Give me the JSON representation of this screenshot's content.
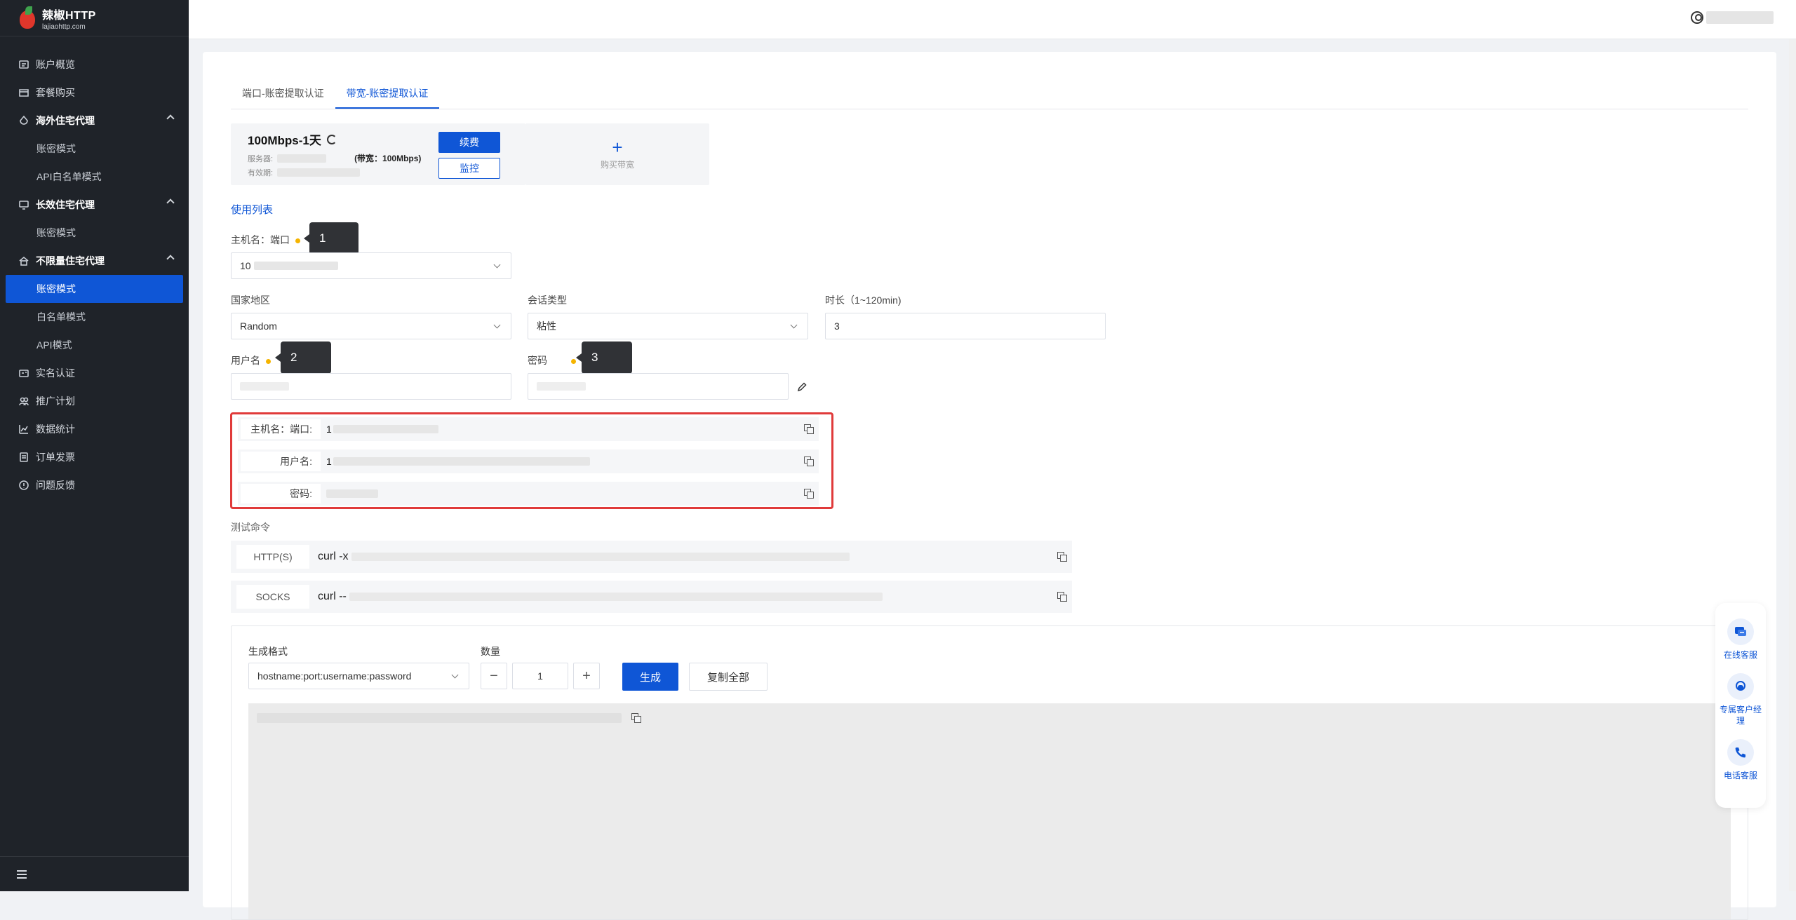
{
  "brand": {
    "name": "辣椒HTTP",
    "domain": "lajiaohttp.com"
  },
  "sidebar": {
    "items": [
      {
        "label": "账户概览",
        "icon": "dashboard-icon",
        "type": "item"
      },
      {
        "label": "套餐购买",
        "icon": "package-icon",
        "type": "item"
      },
      {
        "label": "海外住宅代理",
        "icon": "residential-icon",
        "type": "group"
      },
      {
        "label": "账密模式",
        "type": "sub"
      },
      {
        "label": "API白名单模式",
        "type": "sub"
      },
      {
        "label": "长效住宅代理",
        "icon": "monitor-icon",
        "type": "group"
      },
      {
        "label": "账密模式",
        "type": "sub"
      },
      {
        "label": "不限量住宅代理",
        "icon": "home-icon",
        "type": "group"
      },
      {
        "label": "账密模式",
        "type": "sub-active"
      },
      {
        "label": "白名单模式",
        "type": "sub"
      },
      {
        "label": "API模式",
        "type": "sub"
      },
      {
        "label": "实名认证",
        "icon": "id-card-icon",
        "type": "item"
      },
      {
        "label": "推广计划",
        "icon": "people-icon",
        "type": "item"
      },
      {
        "label": "数据统计",
        "icon": "chart-icon",
        "type": "item"
      },
      {
        "label": "订单发票",
        "icon": "invoice-icon",
        "type": "item"
      },
      {
        "label": "问题反馈",
        "icon": "feedback-icon",
        "type": "item"
      }
    ]
  },
  "tabs": [
    {
      "label": "端口-账密提取认证",
      "active": false
    },
    {
      "label": "带宽-账密提取认证",
      "active": true
    }
  ],
  "plan": {
    "title": "100Mbps-1天",
    "server_label": "服务器:",
    "bandwidth_text": "(带宽：100Mbps)",
    "expiry_label": "有效期:",
    "renew_button": "续费",
    "monitor_button": "监控"
  },
  "buy": {
    "label": "购买带宽"
  },
  "usage_list_title": "使用列表",
  "form": {
    "host_port_label": "主机名：端口",
    "host_port_value": "10",
    "tip1": "1",
    "country_label": "国家地区",
    "country_value": "Random",
    "session_label": "会话类型",
    "session_value": "粘性",
    "duration_label": "时长（1~120min)",
    "duration_value": "3",
    "username_label": "用户名",
    "tip2": "2",
    "password_label": "密码",
    "tip3": "3"
  },
  "result": {
    "host_label": "主机名：端口:",
    "host_value": "1",
    "user_label": "用户名:",
    "user_value": "1",
    "pass_label": "密码:"
  },
  "test": {
    "title": "测试命令",
    "http_label": "HTTP(S)",
    "http_cmd": "curl -x",
    "socks_label": "SOCKS",
    "socks_cmd": "curl --"
  },
  "generator": {
    "format_label": "生成格式",
    "format_value": "hostname:port:username:password",
    "qty_label": "数量",
    "qty_value": "1",
    "minus": "−",
    "plus": "+",
    "generate_button": "生成",
    "copy_all_button": "复制全部"
  },
  "float": {
    "online": "在线客服",
    "manager": "专属客户经理",
    "phone": "电话客服"
  },
  "colors": {
    "accent": "#0f56d6",
    "sidebar_bg": "#1f2329",
    "highlight_border": "#e03a3a",
    "dot": "#f5b400"
  }
}
